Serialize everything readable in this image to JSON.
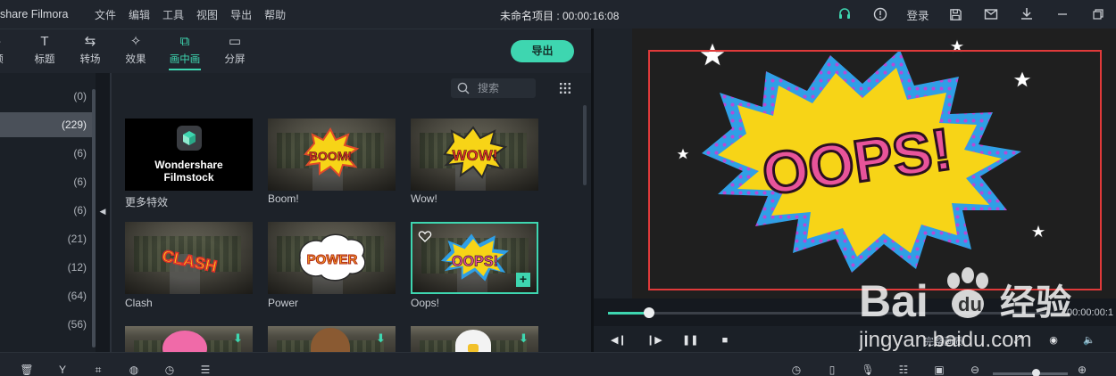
{
  "window": {
    "app_title": "share Filmora",
    "project_title": "未命名项目 : 00:00:16:08",
    "login_label": "登录",
    "menu": [
      "文件",
      "编辑",
      "工具",
      "视图",
      "导出",
      "帮助"
    ]
  },
  "toolbar": {
    "tabs": [
      {
        "label": "频",
        "icon": "music-note-icon"
      },
      {
        "label": "标题",
        "icon": "text-icon"
      },
      {
        "label": "转场",
        "icon": "transition-icon"
      },
      {
        "label": "效果",
        "icon": "effects-icon"
      },
      {
        "label": "画中画",
        "icon": "pip-icon",
        "active": true
      },
      {
        "label": "分屏",
        "icon": "split-screen-icon"
      }
    ],
    "export_label": "导出"
  },
  "categories": {
    "items": [
      {
        "count": "(0)"
      },
      {
        "count": "(229)",
        "selected": true
      },
      {
        "count": "(6)"
      },
      {
        "count": "(6)"
      },
      {
        "count": "(6)"
      },
      {
        "count": "(21)"
      },
      {
        "count": "(12)"
      },
      {
        "count": "(64)"
      },
      {
        "count": "(56)"
      }
    ]
  },
  "library": {
    "search_placeholder": "搜索",
    "filmstock_line1": "Wondershare",
    "filmstock_line2": "Filmstock",
    "items": [
      {
        "caption": "更多特效"
      },
      {
        "caption": "Boom!",
        "sticker": "BOOM!"
      },
      {
        "caption": "Wow!",
        "sticker": "WOW!"
      },
      {
        "caption": "Clash",
        "sticker": "CLASH"
      },
      {
        "caption": "Power",
        "sticker": "POWER"
      },
      {
        "caption": "Oops!",
        "sticker": "OOPS!",
        "selected": true
      }
    ]
  },
  "preview": {
    "sticker_text": "OOPS!",
    "timecode": "00:00:00:1",
    "progress": 0.09,
    "quality_label": "完整画质"
  },
  "watermark": {
    "brand": "Bai",
    "brand2": "du",
    "cn": "经验",
    "url": "jingyan.baidu.com"
  },
  "colors": {
    "accent": "#3ed6b0",
    "frame_red": "#e03a3a",
    "sticker_yellow": "#f7d417",
    "sticker_blue": "#2f9fe6",
    "sticker_pink": "#e8549a"
  }
}
